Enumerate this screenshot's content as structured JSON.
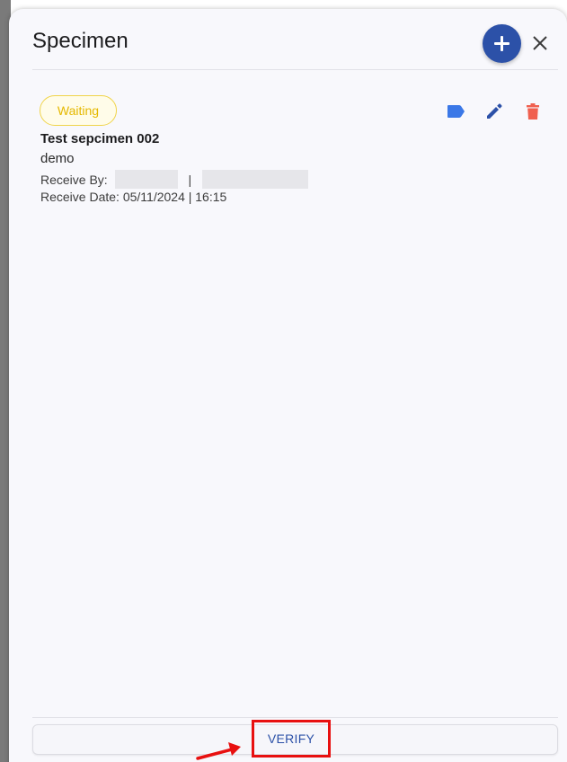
{
  "dialog": {
    "title": "Specimen"
  },
  "specimen": {
    "status": "Waiting",
    "name": "Test sepcimen 002",
    "description": "demo",
    "receive_by_label": "Receive By:",
    "receive_by_separator": "|",
    "receive_date_label": "Receive Date:",
    "receive_date_value": "05/11/2024 | 16:15"
  },
  "footer": {
    "verify_label": "VERIFY"
  },
  "colors": {
    "accent": "#2c51a8",
    "status_waiting": "#e5b800",
    "tag_icon": "#3b78e7",
    "edit_icon": "#2c51a8",
    "delete_icon": "#f0604f",
    "highlight": "#e81010"
  },
  "icons": {
    "add": "plus-icon",
    "close": "close-icon",
    "tag": "label-icon",
    "edit": "pencil-icon",
    "delete": "trash-icon"
  }
}
